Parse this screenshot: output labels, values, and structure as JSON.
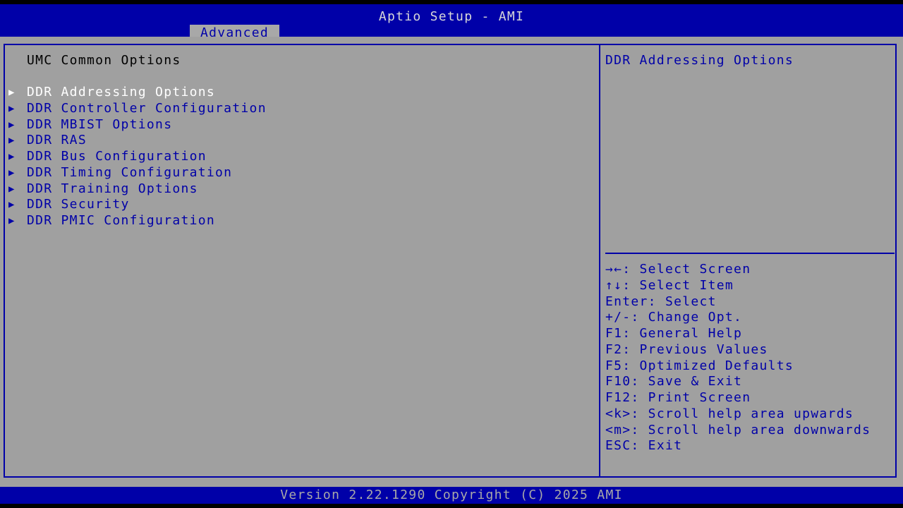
{
  "header": {
    "title": "Aptio Setup - AMI",
    "active_tab": "Advanced"
  },
  "main": {
    "section_title": "UMC Common Options",
    "arrow_glyph": "▶",
    "items": [
      {
        "label": "DDR Addressing Options",
        "selected": true
      },
      {
        "label": "DDR Controller Configuration"
      },
      {
        "label": "DDR MBIST Options"
      },
      {
        "label": "DDR RAS"
      },
      {
        "label": "DDR Bus Configuration"
      },
      {
        "label": "DDR Timing Configuration"
      },
      {
        "label": "DDR Training Options"
      },
      {
        "label": "DDR Security"
      },
      {
        "label": "DDR PMIC Configuration"
      }
    ]
  },
  "help": {
    "text": "DDR Addressing Options",
    "keys": [
      "→←: Select Screen",
      "↑↓: Select Item",
      "Enter: Select",
      "+/-: Change Opt.",
      "F1: General Help",
      "F2: Previous Values",
      "F5: Optimized Defaults",
      "F10: Save & Exit",
      "F12: Print Screen",
      "<k>: Scroll help area upwards",
      "<m>: Scroll help area downwards",
      "ESC: Exit"
    ]
  },
  "footer": {
    "version": "Version 2.22.1290 Copyright (C) 2025 AMI"
  },
  "colors": {
    "bar_blue": "#0000a8",
    "panel_gray": "#a0a0a0",
    "selected_text": "#ffffff",
    "item_text": "#0000a8"
  }
}
